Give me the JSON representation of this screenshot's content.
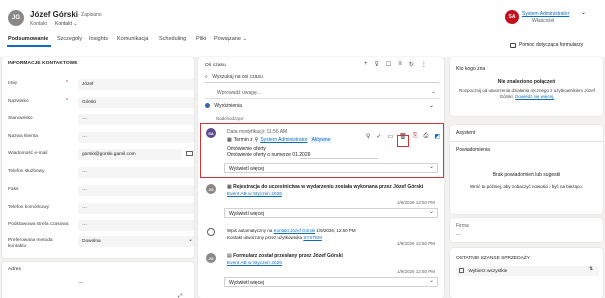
{
  "header": {
    "avatar_initials": "JG",
    "name": "Józef Górski",
    "save_status": "- Zapisano",
    "entity_type": "Kontakt",
    "form_name": "Kontakt",
    "user_initials": "SA",
    "user_name": "System Administrator",
    "user_role": "Właściciel",
    "help_button": "Pomoc dotycząca formularzy",
    "colors": {
      "accent": "#0f6cbd",
      "avatar_gray": "#8a8886",
      "user_red": "#c50f1f",
      "highlight": "#d13438"
    }
  },
  "tabs": [
    {
      "label": "Podsumowanie"
    },
    {
      "label": "Szczegóły"
    },
    {
      "label": "Insights"
    },
    {
      "label": "Komunikacja"
    },
    {
      "label": "Scheduling"
    },
    {
      "label": "Pliki"
    },
    {
      "label": "Powiązane"
    }
  ],
  "contact": {
    "title": "INFORMACJE KONTAKTOWE",
    "fields": [
      {
        "label": "Imię",
        "value": "Józef",
        "required": true
      },
      {
        "label": "Nazwisko",
        "value": "Górski",
        "required": true
      },
      {
        "label": "Stanowisko",
        "value": "---",
        "required": false
      },
      {
        "label": "Nazwa klienta",
        "value": "---",
        "required": false
      },
      {
        "label": "Wiadomość e-mail",
        "value": "gorski@gorski.gamil.com",
        "required": false
      },
      {
        "label": "Telefon służbowy",
        "value": "---",
        "required": false
      },
      {
        "label": "Faks",
        "value": "---",
        "required": false
      },
      {
        "label": "Telefon komórkowy",
        "value": "---",
        "required": false
      },
      {
        "label": "Podstawowa strefa czasowa",
        "value": "---",
        "required": false
      },
      {
        "label": "Preferowana metoda kontaktu",
        "value": "Dowolna",
        "required": false
      }
    ],
    "address_title": "Adres"
  },
  "timeline": {
    "title": "Oś czasu",
    "search_placeholder": "Wyszukaj na osi czasu",
    "note_placeholder": "Wprowadź uwagę...",
    "highlights_label": "Wyróżnienia",
    "upcoming_label": "Nadchodzące",
    "items": [
      {
        "initials": "SA",
        "modified": "Data modyfikacji: 11:56 AM",
        "prefix": "Termin z",
        "owner": "System Administrator",
        "status": "Aktywne",
        "line1": "Omówienie oferty",
        "line2": "Omówienie oferty o numerze 01.2026",
        "expand": "Wyświetl więcej"
      },
      {
        "initials": "JG",
        "title": "Rejestracja do uczestnictwa w wydarzeniu została wykonana przez Józef Górski",
        "link": "Event AB w Styczeń 2026",
        "date": "1/9/2026 12:50 PM",
        "expand": "Wyświetl więcej"
      },
      {
        "initials": "JG",
        "auto_text_a": "Wpis automatyczny",
        "auto_text_b": "na",
        "auto_link": "Kontakt Józef Górski",
        "auto_date": "1/9/2026, 12:50 PM",
        "created_prefix": "Kontakt utworzony przez użytkownika",
        "created_by": "SYSTEM",
        "date": "1/9/2026 12:50 PM"
      },
      {
        "initials": "JG",
        "title": "Formularz został przesłany przez Józef Górski",
        "link": "Event AB w Styczeń 2026",
        "date": "1/9/2026 12:50 PM",
        "expand": "Wyświetl więcej"
      }
    ]
  },
  "who_knows": {
    "title": "Kto kogo zna",
    "empty_title": "Nie znaleziono połączeń",
    "desc": "Rozpocznij od utworzenia działania ręcznego z użytkownikiem Józef Górski.",
    "link": "Dowiedz się więcej."
  },
  "assistant": {
    "title": "Asystent",
    "notifications": "Powiadomienia",
    "empty": "Brak powiadomień lub sugestii",
    "desc": "Wróć tu później, aby zobaczyć nowości i być na bieżąco."
  },
  "firm": {
    "label": "Firma",
    "value": "---"
  },
  "opportunities": {
    "title": "OSTATNIE SZANSE SPRZEDAŻY",
    "select_all": "Wybierz wszystkie"
  }
}
